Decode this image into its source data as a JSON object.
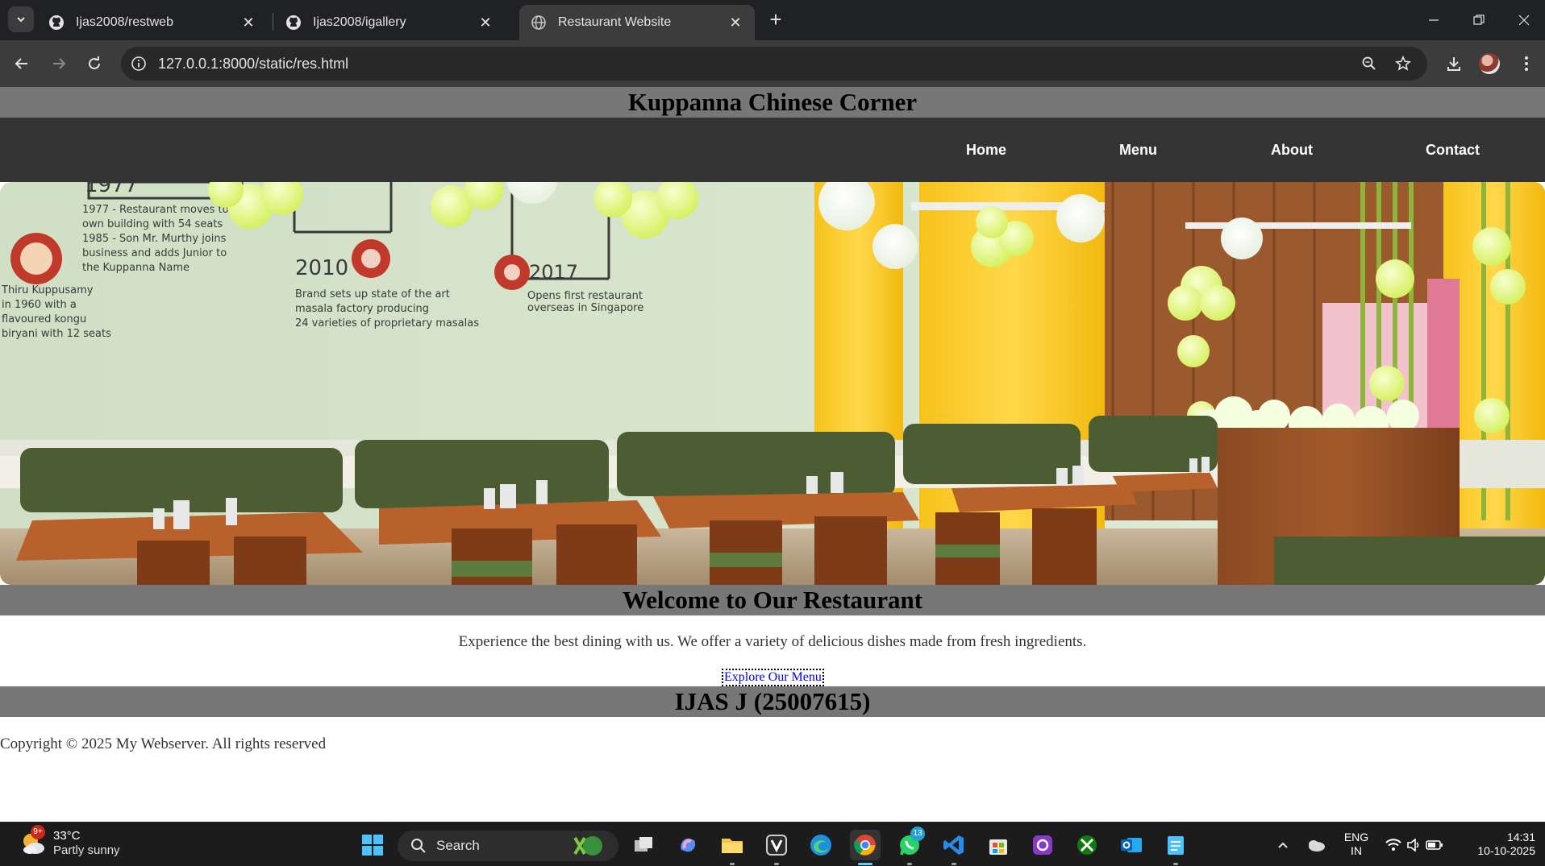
{
  "browser": {
    "tabs": [
      {
        "title": "Ijas2008/restweb",
        "icon": "github-icon"
      },
      {
        "title": "Ijas2008/igallery",
        "icon": "github-icon"
      },
      {
        "title": "Restaurant Website",
        "icon": "globe-icon",
        "active": true
      }
    ],
    "url": "127.0.0.1:8000/static/res.html"
  },
  "site": {
    "title": "Kuppanna Chinese Corner",
    "nav": [
      "Home",
      "Menu",
      "About",
      "Contact"
    ],
    "hero_alt": "Restaurant interior",
    "hero_wall_text": {
      "y1977": "1977",
      "y2010": "2010",
      "y2017": "2017"
    },
    "welcome_title": "Welcome to Our Restaurant",
    "welcome_text": "Experience the best dining with us. We offer a variety of delicious dishes made from fresh ingredients.",
    "cta": "Explore Our Menu",
    "footer_title": "IJAS J (25007615)",
    "copyright": "Copyright © 2025 My Webserver. All rights reserved"
  },
  "taskbar": {
    "weather_temp": "33°C",
    "weather_desc": "Partly sunny",
    "weather_badge": "9+",
    "search_label": "Search",
    "whatsapp_badge": "13",
    "lang_top": "ENG",
    "lang_bottom": "IN",
    "time": "14:31",
    "date": "10-10-2025"
  },
  "colors": {
    "header_bar": "#777777",
    "nav_bar": "#333333",
    "chrome_dark": "#202124",
    "accent": "#60cdff"
  }
}
